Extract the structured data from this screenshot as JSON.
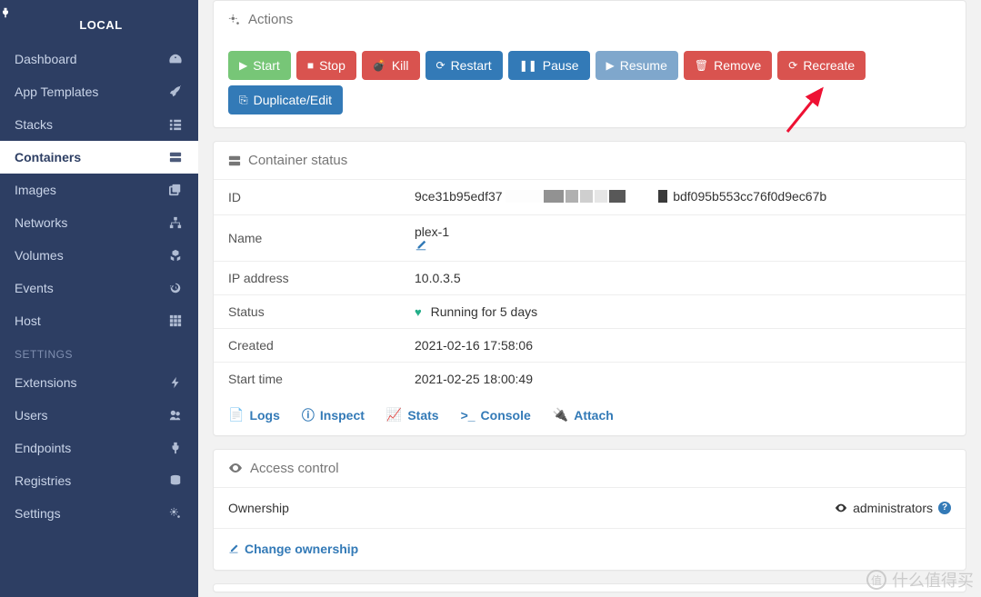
{
  "sidebar": {
    "local_label": "LOCAL",
    "items": [
      {
        "label": "Dashboard"
      },
      {
        "label": "App Templates"
      },
      {
        "label": "Stacks"
      },
      {
        "label": "Containers"
      },
      {
        "label": "Images"
      },
      {
        "label": "Networks"
      },
      {
        "label": "Volumes"
      },
      {
        "label": "Events"
      },
      {
        "label": "Host"
      }
    ],
    "settings_header": "SETTINGS",
    "settings": [
      {
        "label": "Extensions"
      },
      {
        "label": "Users"
      },
      {
        "label": "Endpoints"
      },
      {
        "label": "Registries"
      },
      {
        "label": "Settings"
      }
    ]
  },
  "actions": {
    "title": "Actions",
    "buttons": {
      "start": "Start",
      "stop": "Stop",
      "kill": "Kill",
      "restart": "Restart",
      "pause": "Pause",
      "resume": "Resume",
      "remove": "Remove",
      "recreate": "Recreate",
      "duplicate": "Duplicate/Edit"
    }
  },
  "status": {
    "title": "Container status",
    "rows": {
      "id_label": "ID",
      "id_value_prefix": "9ce31b95edf37",
      "id_value_suffix": "bdf095b553cc76f0d9ec67b",
      "name_label": "Name",
      "name_value": "plex-1",
      "ip_label": "IP address",
      "ip_value": "10.0.3.5",
      "status_label": "Status",
      "status_value": "Running for 5 days",
      "created_label": "Created",
      "created_value": "2021-02-16 17:58:06",
      "start_label": "Start time",
      "start_value": "2021-02-25 18:00:49"
    },
    "links": {
      "logs": "Logs",
      "inspect": "Inspect",
      "stats": "Stats",
      "console": "Console",
      "attach": "Attach"
    }
  },
  "access": {
    "title": "Access control",
    "ownership_label": "Ownership",
    "ownership_value": "administrators",
    "change_label": "Change ownership"
  },
  "watermark": "什么值得买"
}
